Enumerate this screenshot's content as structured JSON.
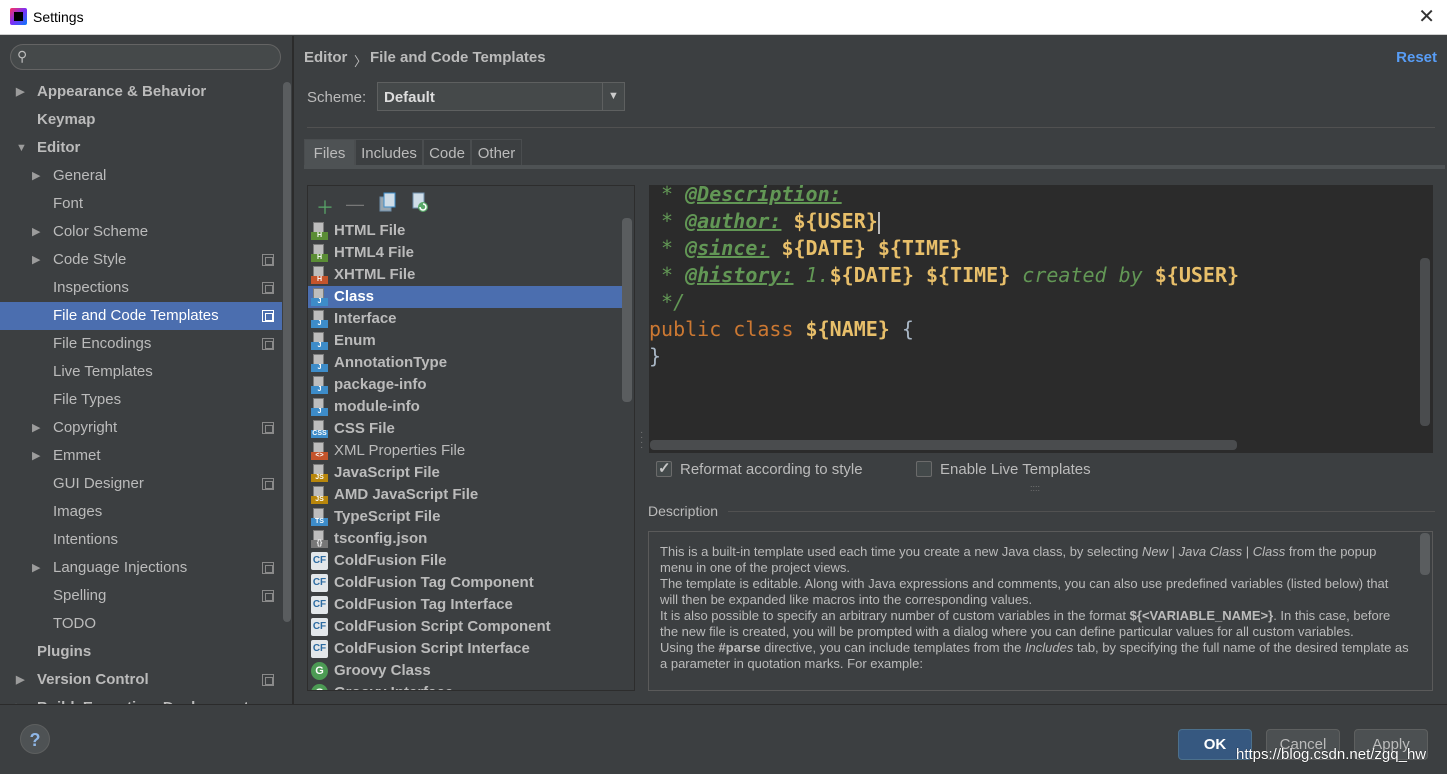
{
  "window": {
    "title": "Settings",
    "close_symbol": "✕"
  },
  "sidebar": {
    "search_placeholder": "",
    "items": [
      {
        "label": "Appearance & Behavior",
        "bold": true,
        "arrow": "▶",
        "level": 0
      },
      {
        "label": "Keymap",
        "bold": true,
        "arrow": "",
        "level": 0
      },
      {
        "label": "Editor",
        "bold": true,
        "arrow": "▼",
        "level": 0
      },
      {
        "label": "General",
        "bold": false,
        "arrow": "▶",
        "level": 1
      },
      {
        "label": "Font",
        "bold": false,
        "arrow": "",
        "level": 1
      },
      {
        "label": "Color Scheme",
        "bold": false,
        "arrow": "▶",
        "level": 1
      },
      {
        "label": "Code Style",
        "bold": false,
        "arrow": "▶",
        "level": 1,
        "project": true
      },
      {
        "label": "Inspections",
        "bold": false,
        "arrow": "",
        "level": 1,
        "project": true
      },
      {
        "label": "File and Code Templates",
        "bold": false,
        "arrow": "",
        "level": 1,
        "project": true,
        "selected": true
      },
      {
        "label": "File Encodings",
        "bold": false,
        "arrow": "",
        "level": 1,
        "project": true
      },
      {
        "label": "Live Templates",
        "bold": false,
        "arrow": "",
        "level": 1
      },
      {
        "label": "File Types",
        "bold": false,
        "arrow": "",
        "level": 1
      },
      {
        "label": "Copyright",
        "bold": false,
        "arrow": "▶",
        "level": 1,
        "project": true
      },
      {
        "label": "Emmet",
        "bold": false,
        "arrow": "▶",
        "level": 1
      },
      {
        "label": "GUI Designer",
        "bold": false,
        "arrow": "",
        "level": 1,
        "project": true
      },
      {
        "label": "Images",
        "bold": false,
        "arrow": "",
        "level": 1
      },
      {
        "label": "Intentions",
        "bold": false,
        "arrow": "",
        "level": 1
      },
      {
        "label": "Language Injections",
        "bold": false,
        "arrow": "▶",
        "level": 1,
        "project": true
      },
      {
        "label": "Spelling",
        "bold": false,
        "arrow": "",
        "level": 1,
        "project": true
      },
      {
        "label": "TODO",
        "bold": false,
        "arrow": "",
        "level": 1
      },
      {
        "label": "Plugins",
        "bold": true,
        "arrow": "",
        "level": 0
      },
      {
        "label": "Version Control",
        "bold": true,
        "arrow": "▶",
        "level": 0,
        "project": true
      },
      {
        "label": "Build, Execution, Deployment",
        "bold": true,
        "arrow": "▶",
        "level": 0
      }
    ]
  },
  "breadcrumb": {
    "part1": "Editor",
    "separator": "〉",
    "part2": "File and Code Templates"
  },
  "reset_label": "Reset",
  "scheme": {
    "label": "Scheme:",
    "value": "Default"
  },
  "tabs": [
    "Files",
    "Includes",
    "Code",
    "Other"
  ],
  "active_tab": "Files",
  "toolbar_icons": [
    "add-icon",
    "remove-icon",
    "copy-icon",
    "reset-to-default-icon"
  ],
  "templates": [
    {
      "name": "HTML File",
      "icon": "html",
      "tag": "H",
      "color": "#5a8d35"
    },
    {
      "name": "HTML4 File",
      "icon": "html",
      "tag": "H",
      "color": "#5a8d35"
    },
    {
      "name": "XHTML File",
      "icon": "html",
      "tag": "H",
      "color": "#c4542b"
    },
    {
      "name": "Class",
      "icon": "java",
      "tag": "J",
      "color": "#3d8cc9",
      "selected": true
    },
    {
      "name": "Interface",
      "icon": "java",
      "tag": "J",
      "color": "#3d8cc9"
    },
    {
      "name": "Enum",
      "icon": "java",
      "tag": "J",
      "color": "#3d8cc9"
    },
    {
      "name": "AnnotationType",
      "icon": "java",
      "tag": "J",
      "color": "#3d8cc9"
    },
    {
      "name": "package-info",
      "icon": "java",
      "tag": "J",
      "color": "#3d8cc9"
    },
    {
      "name": "module-info",
      "icon": "java",
      "tag": "J",
      "color": "#3d8cc9"
    },
    {
      "name": "CSS File",
      "icon": "css",
      "tag": "CSS",
      "color": "#3d8cc9"
    },
    {
      "name": "XML Properties File",
      "icon": "xml",
      "tag": "<>",
      "color": "#c4542b",
      "normal": true
    },
    {
      "name": "JavaScript File",
      "icon": "js",
      "tag": "JS",
      "color": "#b8860b"
    },
    {
      "name": "AMD JavaScript File",
      "icon": "js",
      "tag": "JS",
      "color": "#b8860b"
    },
    {
      "name": "TypeScript File",
      "icon": "ts",
      "tag": "TS",
      "color": "#3d8cc9"
    },
    {
      "name": "tsconfig.json",
      "icon": "json",
      "tag": "{}",
      "color": "#777777"
    },
    {
      "name": "ColdFusion File",
      "icon": "cf",
      "tag": "CF",
      "color": "#2d6ca2"
    },
    {
      "name": "ColdFusion Tag Component",
      "icon": "cf",
      "tag": "CF",
      "color": "#2d6ca2"
    },
    {
      "name": "ColdFusion Tag Interface",
      "icon": "cf",
      "tag": "CF",
      "color": "#2d6ca2"
    },
    {
      "name": "ColdFusion Script Component",
      "icon": "cf",
      "tag": "CF",
      "color": "#2d6ca2"
    },
    {
      "name": "ColdFusion Script Interface",
      "icon": "cf",
      "tag": "CF",
      "color": "#2d6ca2"
    },
    {
      "name": "Groovy Class",
      "icon": "groovy",
      "tag": "G",
      "color": "#4c9b54"
    },
    {
      "name": "Groovy Interface",
      "icon": "groovy",
      "tag": "G",
      "color": "#4c9b54"
    }
  ],
  "code": {
    "lines": [
      [
        {
          "t": " * ",
          "c": "c-cm"
        },
        {
          "t": "@Description:",
          "c": "c-tag"
        }
      ],
      [
        {
          "t": " * ",
          "c": "c-cm"
        },
        {
          "t": "@author:",
          "c": "c-tag"
        },
        {
          "t": " ",
          "c": "c-txt"
        },
        {
          "t": "${USER}",
          "c": "c-var"
        },
        {
          "t": "",
          "c": "caret"
        }
      ],
      [
        {
          "t": " * ",
          "c": "c-cm"
        },
        {
          "t": "@since:",
          "c": "c-tag"
        },
        {
          "t": " ",
          "c": "c-txt"
        },
        {
          "t": "${DATE}",
          "c": "c-var"
        },
        {
          "t": " ",
          "c": "c-txt"
        },
        {
          "t": "${TIME}",
          "c": "c-var"
        }
      ],
      [
        {
          "t": " * ",
          "c": "c-cm"
        },
        {
          "t": "@history:",
          "c": "c-tag"
        },
        {
          "t": " 1.",
          "c": "c-cm"
        },
        {
          "t": "${DATE}",
          "c": "c-var"
        },
        {
          "t": " ",
          "c": "c-txt"
        },
        {
          "t": "${TIME}",
          "c": "c-var"
        },
        {
          "t": " created by ",
          "c": "c-cm"
        },
        {
          "t": "${USER}",
          "c": "c-var"
        }
      ],
      [
        {
          "t": " */",
          "c": "c-cm"
        }
      ],
      [
        {
          "t": "public class ",
          "c": "c-kw"
        },
        {
          "t": "${NAME}",
          "c": "c-var"
        },
        {
          "t": " {",
          "c": "c-txt"
        }
      ],
      [
        {
          "t": "}",
          "c": "c-txt"
        }
      ]
    ]
  },
  "options": {
    "reformat_label": "Reformat according to style",
    "reformat_checked": true,
    "live_templates_label": "Enable Live Templates",
    "live_templates_checked": false
  },
  "description": {
    "title": "Description",
    "html_paragraphs": [
      "This is a built-in template used each time you create a new Java class, by selecting <i>New</i> | <i>Java Class</i> | <i>Class</i> from the popup menu in one of the project views.",
      "The template is editable. Along with Java expressions and comments, you can also use predefined variables (listed below) that will then be expanded like macros into the corresponding values.",
      "It is also possible to specify an arbitrary number of custom variables in the format <b>${&lt;VARIABLE_NAME&gt;}</b>. In this case, before the new file is created, you will be prompted with a dialog where you can define particular values for all custom variables.",
      "Using the <b>#parse</b> directive, you can include templates from the <i>Includes</i> tab, by specifying the full name of the desired template as a parameter in quotation marks. For example:"
    ]
  },
  "buttons": {
    "ok": "OK",
    "cancel": "Cancel",
    "apply": "Apply",
    "help": "?"
  },
  "watermark": "https://blog.csdn.net/zgq_hw"
}
